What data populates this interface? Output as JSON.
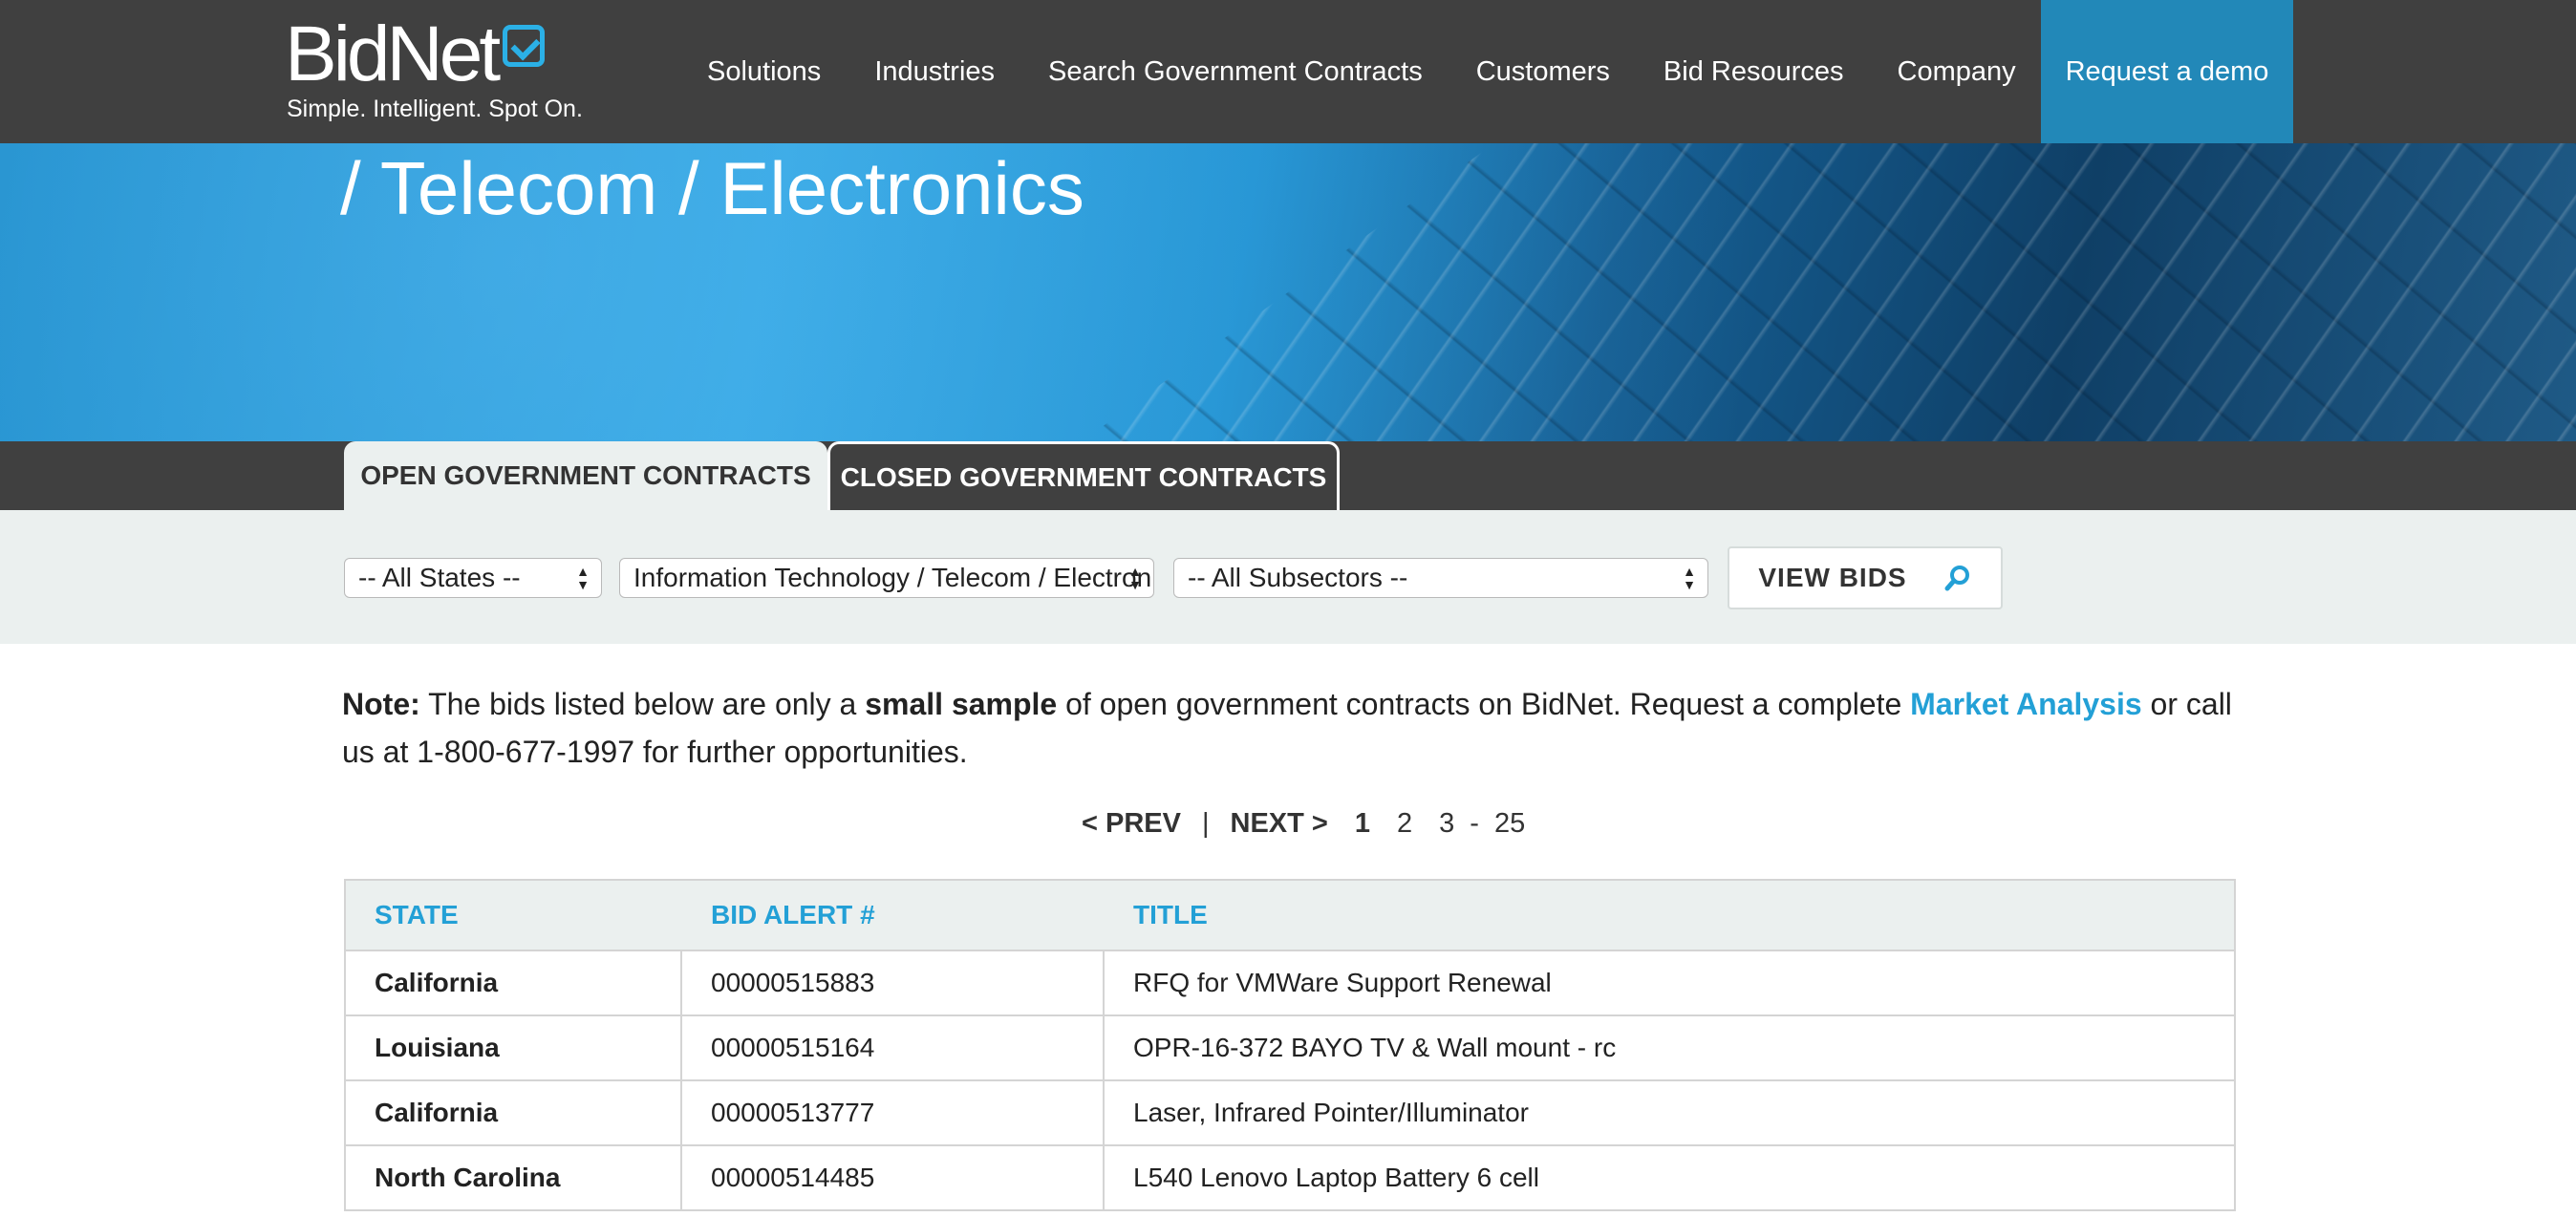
{
  "header": {
    "logo_text": "BidNet",
    "tagline": "Simple. Intelligent. Spot On.",
    "nav": [
      "Solutions",
      "Industries",
      "Search Government Contracts",
      "Customers",
      "Bid Resources",
      "Company"
    ],
    "demo_button": "Request a demo"
  },
  "hero": {
    "title": "/ Telecom / Electronics"
  },
  "tabs": {
    "open": "Open Government Contracts",
    "closed": "Closed Government Contracts"
  },
  "filters": {
    "state": "-- All States --",
    "industry": "Information Technology / Telecom / Electronics",
    "subsector": "-- All Subsectors --",
    "view_button": "VIEW BIDS"
  },
  "note": {
    "label": "Note:",
    "text1": " The bids listed below are only a ",
    "emphasis": "small sample",
    "text2": " of open government contracts on BidNet. Request a complete ",
    "link": "Market Analysis",
    "text3": " or call us at 1-800-677-1997 for further opportunities."
  },
  "pager": {
    "prev": "< PREV",
    "separator": "|",
    "next": "NEXT >",
    "pages": [
      "1",
      "2",
      "3"
    ],
    "dash": "-",
    "last": "25"
  },
  "table": {
    "headers": [
      "STATE",
      "BID ALERT #",
      "TITLE"
    ],
    "rows": [
      {
        "state": "California",
        "bid": "00000515883",
        "title": "RFQ for VMWare Support Renewal"
      },
      {
        "state": "Louisiana",
        "bid": "00000515164",
        "title": "OPR-16-372 BAYO TV & Wall mount - rc"
      },
      {
        "state": "California",
        "bid": "00000513777",
        "title": "Laser, Infrared Pointer/Illuminator"
      },
      {
        "state": "North Carolina",
        "bid": "00000514485",
        "title": "L540 Lenovo Laptop Battery 6 cell"
      }
    ]
  },
  "colors": {
    "header_bg": "#404040",
    "accent_blue": "#23a0d6",
    "demo_button_bg": "#2288b8",
    "filter_bg": "#ebf0ef"
  }
}
